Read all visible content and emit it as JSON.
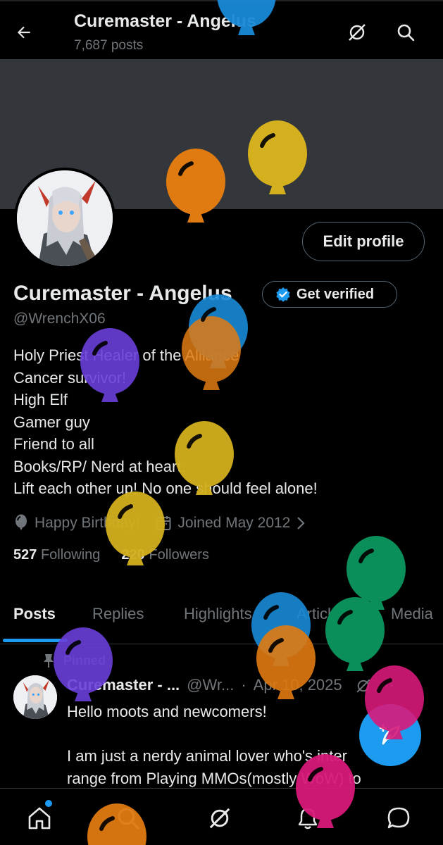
{
  "header": {
    "title": "Curemaster - Angelus",
    "post_count": "7,687 posts"
  },
  "profile": {
    "name": "Curemaster - Angelus",
    "get_verified_label": "Get verified",
    "handle": "@WrenchX06",
    "edit_profile_label": "Edit profile",
    "bio": [
      "Holy Priest Healer of the Alliance",
      "Cancer survivor!",
      "High Elf",
      "Gamer guy",
      "Friend to all",
      "Books/RP/ Nerd at heart.",
      "Lift each other up! No one should feel alone!"
    ],
    "birthday": "Happy Birthday!",
    "joined": "Joined May 2012",
    "following_count": "527",
    "following_label": "Following",
    "followers_count": "220",
    "followers_label": "Followers"
  },
  "tabs": [
    {
      "label": "Posts",
      "active": true
    },
    {
      "label": "Replies",
      "active": false
    },
    {
      "label": "Highlights",
      "active": false
    },
    {
      "label": "Articles",
      "active": false
    },
    {
      "label": "Media",
      "active": false
    }
  ],
  "pinned_post": {
    "pinned_label": "Pinned",
    "author": "Curemaster - ...",
    "handle": "@Wr...",
    "separator": "·",
    "date": "Apr 10, 2025",
    "more": "···",
    "lines": [
      "Hello moots and newcomers!",
      "",
      "I am just a nerdy animal lover who's inter",
      "range from Playing MMOs(mostly WoW) to"
    ]
  },
  "icons": {
    "back": "back-arrow-icon",
    "grok": "grok-icon",
    "search": "search-icon",
    "verified": "verified-badge-icon",
    "balloon": "balloon-icon",
    "calendar": "calendar-icon",
    "pin": "pin-icon",
    "compose": "compose-icon",
    "home": "home-icon",
    "bell": "notifications-icon",
    "messages": "messages-icon"
  },
  "colors": {
    "accent": "#1d9bf0",
    "text": "#e7e9ea",
    "muted": "#71767b",
    "banner": "#33363a",
    "balloon_colors": [
      "#e07b12",
      "#d4b01e",
      "#1a8bd8",
      "#6a3fd9",
      "#0a8f5a",
      "#d91a7a"
    ]
  }
}
